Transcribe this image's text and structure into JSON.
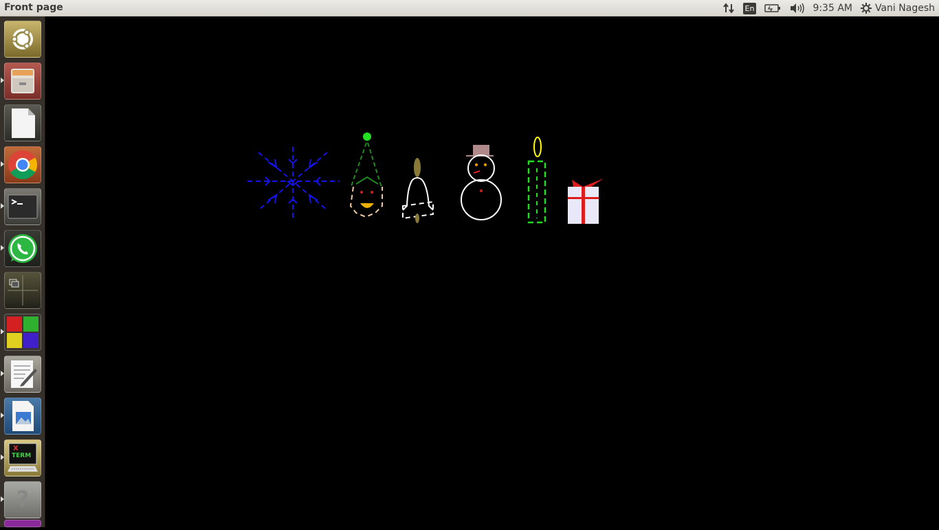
{
  "window": {
    "title": "Front page"
  },
  "panel": {
    "language": "En",
    "time": "9:35 AM",
    "user": "Vani Nagesh",
    "icons": [
      "network-updown-icon",
      "keyboard-language-icon",
      "battery-icon",
      "volume-icon",
      "session-gear-icon"
    ]
  },
  "launcher": {
    "items": [
      {
        "name": "ubuntu-dash-icon",
        "running": false
      },
      {
        "name": "files-icon",
        "running": true
      },
      {
        "name": "libreoffice-icon",
        "running": false
      },
      {
        "name": "chrome-icon",
        "running": true
      },
      {
        "name": "terminal-icon",
        "running": true
      },
      {
        "name": "whatsapp-icon",
        "running": true
      },
      {
        "name": "workspace-switcher-icon",
        "running": false
      },
      {
        "name": "cube-app-icon",
        "running": true
      },
      {
        "name": "text-editor-icon",
        "running": true
      },
      {
        "name": "image-viewer-icon",
        "running": true
      },
      {
        "name": "xterm-icon",
        "running": true
      },
      {
        "name": "help-icon",
        "running": true
      }
    ],
    "xterm_label_x": "X",
    "xterm_label_term": "TERM",
    "help_glyph": "?"
  },
  "drawing": {
    "objects": [
      "snowflake",
      "christmas-tree",
      "bell",
      "snowman",
      "candle",
      "gift-box"
    ],
    "colors": {
      "snowflake": "#1414e8",
      "tree": "#1f8a1f",
      "tree_star": "#22e022",
      "bell": "#ffffff",
      "bell_top": "#8a7a3a",
      "snowman": "#ffffff",
      "hat": "#b08a8a",
      "candle": "#22dd22",
      "flame": "#ffff00",
      "gift": "#e8e8f8",
      "ribbon": "#dd1c1c"
    }
  }
}
